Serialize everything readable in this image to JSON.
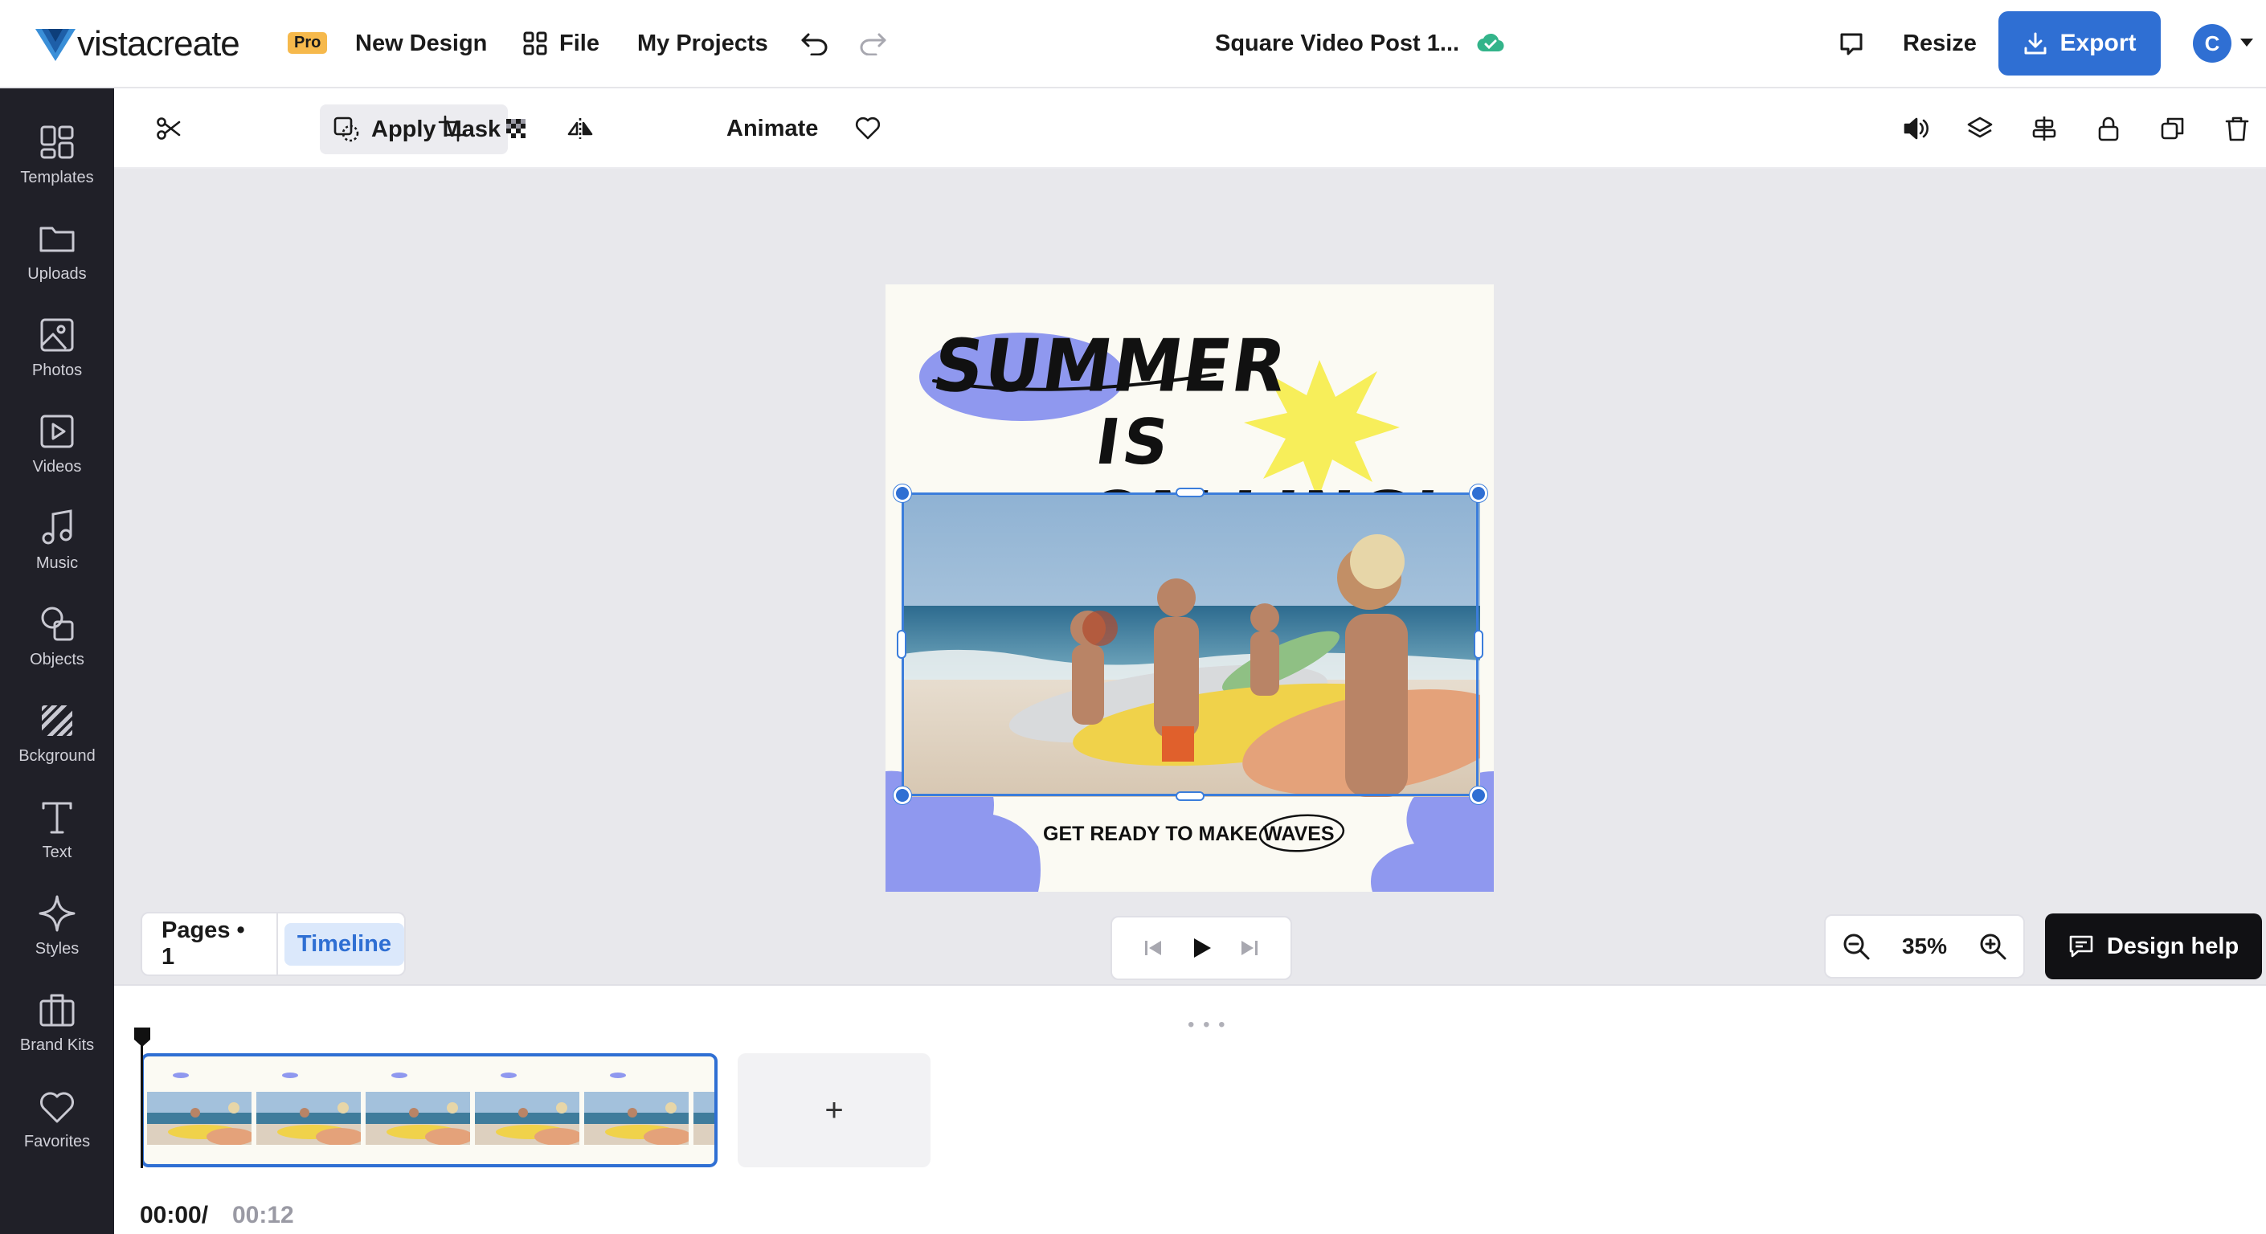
{
  "header": {
    "brand": "vistacreate",
    "plan_badge": "Pro",
    "new_design": "New Design",
    "file": "File",
    "my_projects": "My Projects",
    "document_title": "Square Video Post 1...",
    "resize": "Resize",
    "export": "Export",
    "avatar_initial": "C"
  },
  "sidebar": {
    "items": [
      {
        "label": "Templates",
        "icon": "templates-icon"
      },
      {
        "label": "Uploads",
        "icon": "folder-icon"
      },
      {
        "label": "Photos",
        "icon": "image-icon"
      },
      {
        "label": "Videos",
        "icon": "video-icon"
      },
      {
        "label": "Music",
        "icon": "music-icon"
      },
      {
        "label": "Objects",
        "icon": "objects-icon"
      },
      {
        "label": "Bckground",
        "icon": "background-icon"
      },
      {
        "label": "Text",
        "icon": "text-icon"
      },
      {
        "label": "Styles",
        "icon": "sparkle-icon"
      },
      {
        "label": "Brand Kits",
        "icon": "briefcase-icon"
      },
      {
        "label": "Favorites",
        "icon": "heart-icon"
      }
    ]
  },
  "toolbar": {
    "apply_mask": "Apply Mask",
    "animate": "Animate"
  },
  "canvas": {
    "headline_1": "SUMMER",
    "headline_2": "IS CALLING!",
    "tagline": "GET READY TO MAKE ",
    "tagline_highlight": "WAVES"
  },
  "bottom": {
    "pages_label": "Pages • 1",
    "timeline_tab": "Timeline",
    "zoom": "35%",
    "design_help": "Design help"
  },
  "timeline": {
    "current_time": "00:00/",
    "total_time": "00:12",
    "add_page": "+"
  },
  "colors": {
    "accent": "#2f6fd3",
    "sidebar_bg": "#202028",
    "lavender": "#8f98ef",
    "sun_yellow": "#f7ee5a"
  }
}
